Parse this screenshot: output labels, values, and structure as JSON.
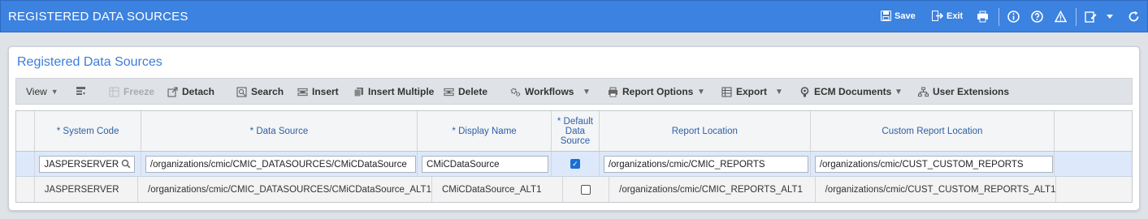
{
  "app": {
    "title": "REGISTERED DATA SOURCES",
    "save_label": "Save",
    "exit_label": "Exit"
  },
  "panel": {
    "title": "Registered Data Sources"
  },
  "toolbar": {
    "view": "View",
    "freeze": "Freeze",
    "detach": "Detach",
    "search": "Search",
    "insert": "Insert",
    "insert_multiple": "Insert Multiple",
    "delete": "Delete",
    "workflows": "Workflows",
    "report_options": "Report Options",
    "export": "Export",
    "ecm_documents": "ECM Documents",
    "user_extensions": "User Extensions"
  },
  "grid": {
    "columns": {
      "system_code": "* System Code",
      "data_source": "* Data Source",
      "display_name": "* Display Name",
      "default_line1": "* Default",
      "default_line2": "Data",
      "default_line3": "Source",
      "report_location": "Report Location",
      "custom_report_location": "Custom Report Location"
    },
    "rows": [
      {
        "system_code": "JASPERSERVER",
        "data_source": "/organizations/cmic/CMIC_DATASOURCES/CMiCDataSource",
        "display_name": "CMiCDataSource",
        "default": true,
        "report_location": "/organizations/cmic/CMIC_REPORTS",
        "custom_report_location": "/organizations/cmic/CUST_CUSTOM_REPORTS"
      },
      {
        "system_code": "JASPERSERVER",
        "data_source": "/organizations/cmic/CMIC_DATASOURCES/CMiCDataSource_ALT1",
        "display_name": "CMiCDataSource_ALT1",
        "default": false,
        "report_location": "/organizations/cmic/CMIC_REPORTS_ALT1",
        "custom_report_location": "/organizations/cmic/CUST_CUSTOM_REPORTS_ALT1"
      }
    ]
  },
  "colors": {
    "titlebar": "#3c82e0",
    "accent": "#3b7ddd",
    "selected_row": "#dde9fa"
  }
}
